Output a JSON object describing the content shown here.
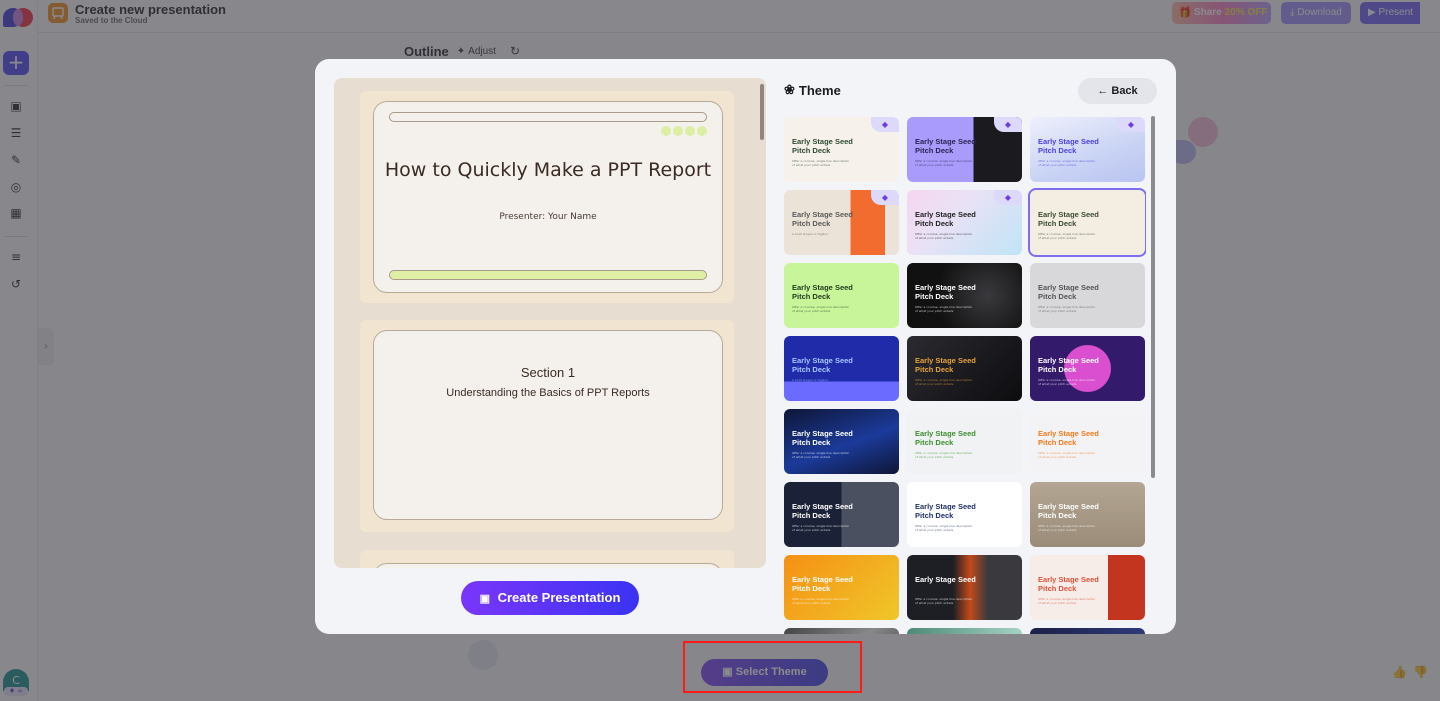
{
  "app": {
    "document_title": "Create new presentation",
    "document_status": "Saved to the Cloud"
  },
  "topbar": {
    "share_label": "Share",
    "share_discount": "20% OFF",
    "download_label": "Download",
    "present_label": "Present"
  },
  "sidebar": {
    "new_label": "+",
    "items": [
      {
        "name": "presentations-icon",
        "glyph": "▣"
      },
      {
        "name": "document-icon",
        "glyph": "☰"
      },
      {
        "name": "magic-pen-icon",
        "glyph": "✎"
      },
      {
        "name": "target-icon",
        "glyph": "◎"
      },
      {
        "name": "apps-grid-icon",
        "glyph": "▦"
      },
      {
        "name": "layers-icon",
        "glyph": "≡"
      },
      {
        "name": "history-icon",
        "glyph": "↺"
      }
    ],
    "avatar_initial": "C",
    "avatar_badge": "♦ ∞",
    "collapse_glyph": "›"
  },
  "outline": {
    "title": "Outline",
    "adjust_label": "Adjust",
    "adjust_glyph": "✦",
    "refresh_glyph": "↻"
  },
  "modal": {
    "preview": {
      "slides": [
        {
          "type": "title",
          "title": "How to Quickly Make a PPT Report",
          "subtitle": "Presenter: Your Name"
        },
        {
          "type": "section",
          "title": "Section 1",
          "subtitle": "Understanding the Basics of PPT Reports"
        }
      ]
    },
    "create_button": "Create Presentation",
    "create_glyph": "▣",
    "theme_heading": "Theme",
    "theme_glyph": "❀",
    "back_label": "←  Back",
    "premium_glyph": "◆",
    "themes": [
      {
        "title": "Early Stage Seed Pitch Deck",
        "subtitle": "Offer a concise, single line description of what your pitch entails",
        "premium": true,
        "selected": false,
        "bg": "#f6f1ea",
        "fg": "#2e4a32"
      },
      {
        "title": "Early Stage Seed Pitch Deck",
        "subtitle": "Offer a concise, single line description of what your pitch entails",
        "premium": true,
        "selected": false,
        "bg": "#1b1a1f",
        "fg": "#2a2453"
      },
      {
        "title": "Early Stage Seed Pitch Deck",
        "subtitle": "Offer a concise, single line description of what your pitch entails",
        "premium": true,
        "selected": false,
        "bg": "#d7def5",
        "fg": "#4a3fe0"
      },
      {
        "title": "Early Stage Seed Pitch Deck",
        "subtitle": "A brief slogan or tagline",
        "premium": true,
        "selected": false,
        "bg": "#ece3d8",
        "fg": "#5a5a5a"
      },
      {
        "title": "Early Stage Seed Pitch Deck",
        "subtitle": "Offer a concise, single line description of what your pitch entails",
        "premium": true,
        "selected": false,
        "bg": "#e8d9f3",
        "fg": "#222"
      },
      {
        "title": "Early Stage Seed Pitch Deck",
        "subtitle": "Offer a concise, single line description of what your pitch entails",
        "premium": false,
        "selected": true,
        "bg": "#f4eee2",
        "fg": "#3a4a30"
      },
      {
        "title": "Early Stage Seed Pitch Deck",
        "subtitle": "Offer a concise, single line description of what your pitch entails",
        "premium": false,
        "selected": false,
        "bg": "#c9f59a",
        "fg": "#1f3b1d"
      },
      {
        "title": "Early Stage Seed Pitch Deck",
        "subtitle": "Offer a concise, single line description of what your pitch entails",
        "premium": false,
        "selected": false,
        "bg": "#121214",
        "fg": "#ffffff"
      },
      {
        "title": "Early Stage Seed Pitch Deck",
        "subtitle": "Offer a concise, single line description of what your pitch entails",
        "premium": false,
        "selected": false,
        "bg": "#d8d8da",
        "fg": "#555"
      },
      {
        "title": "Early Stage Seed Pitch Deck",
        "subtitle": "A brief slogan or tagline",
        "premium": false,
        "selected": false,
        "bg": "#2f2fb8",
        "fg": "#a6c6ff"
      },
      {
        "title": "Early Stage Seed Pitch Deck",
        "subtitle": "Offer a concise, single line description of what your pitch entails",
        "premium": false,
        "selected": false,
        "bg": "#141218",
        "fg": "#e8a33a"
      },
      {
        "title": "Early Stage Seed Pitch Deck",
        "subtitle": "Offer a concise, single line description of what your pitch entails",
        "premium": false,
        "selected": false,
        "bg": "#3a1c6e",
        "fg": "#ffffff"
      },
      {
        "title": "Early Stage Seed Pitch Deck",
        "subtitle": "Offer a concise, single line description of what your pitch entails",
        "premium": false,
        "selected": false,
        "bg": "#0e1636",
        "fg": "#ffffff"
      },
      {
        "title": "Early Stage Seed Pitch Deck",
        "subtitle": "Offer a concise, single line description of what your pitch entails",
        "premium": false,
        "selected": false,
        "bg": "#f1f2f4",
        "fg": "#3d8f2e"
      },
      {
        "title": "Early Stage Seed Pitch Deck",
        "subtitle": "Offer a concise, single line description of what your pitch entails",
        "premium": false,
        "selected": false,
        "bg": "#f3f3f5",
        "fg": "#f07a1a"
      },
      {
        "title": "Early Stage Seed Pitch Deck",
        "subtitle": "Offer a concise, single line description of what your pitch entails",
        "premium": false,
        "selected": false,
        "bg": "#22293a",
        "fg": "#ffffff"
      },
      {
        "title": "Early Stage Seed Pitch Deck",
        "subtitle": "Offer a concise, single line description of what your pitch entails",
        "premium": false,
        "selected": false,
        "bg": "#ffffff",
        "fg": "#23306a"
      },
      {
        "title": "Early Stage Seed Pitch Deck",
        "subtitle": "Offer a concise, single line description of what your pitch entails",
        "premium": false,
        "selected": false,
        "bg": "#a89a88",
        "fg": "#ffffff"
      },
      {
        "title": "Early Stage Seed Pitch Deck",
        "subtitle": "Offer a concise, single line description of what your pitch entails",
        "premium": false,
        "selected": false,
        "bg": "#f5a114",
        "fg": "#ffffff"
      },
      {
        "title": "Early Stage Seed",
        "subtitle": "Offer a concise, single line description of what your pitch entails",
        "premium": false,
        "selected": false,
        "bg": "#1d1f24",
        "fg": "#ffffff"
      },
      {
        "title": "Early Stage Seed Pitch Deck",
        "subtitle": "Offer a concise, single line description of what your pitch entails",
        "premium": false,
        "selected": false,
        "bg": "#f6ece8",
        "fg": "#e0513a"
      },
      {
        "title": "",
        "subtitle": "",
        "premium": false,
        "selected": false,
        "bg": "#5a5a5e",
        "fg": "#ffffff"
      },
      {
        "title": "",
        "subtitle": "",
        "premium": false,
        "selected": false,
        "bg": "#5a9582",
        "fg": "#ffffff"
      },
      {
        "title": "",
        "subtitle": "",
        "premium": false,
        "selected": false,
        "bg": "#252a55",
        "fg": "#ffffff"
      }
    ]
  },
  "footer": {
    "select_theme_label": "Select Theme",
    "select_theme_glyph": "▣",
    "thumbs_up_glyph": "👍",
    "thumbs_down_glyph": "👎"
  }
}
